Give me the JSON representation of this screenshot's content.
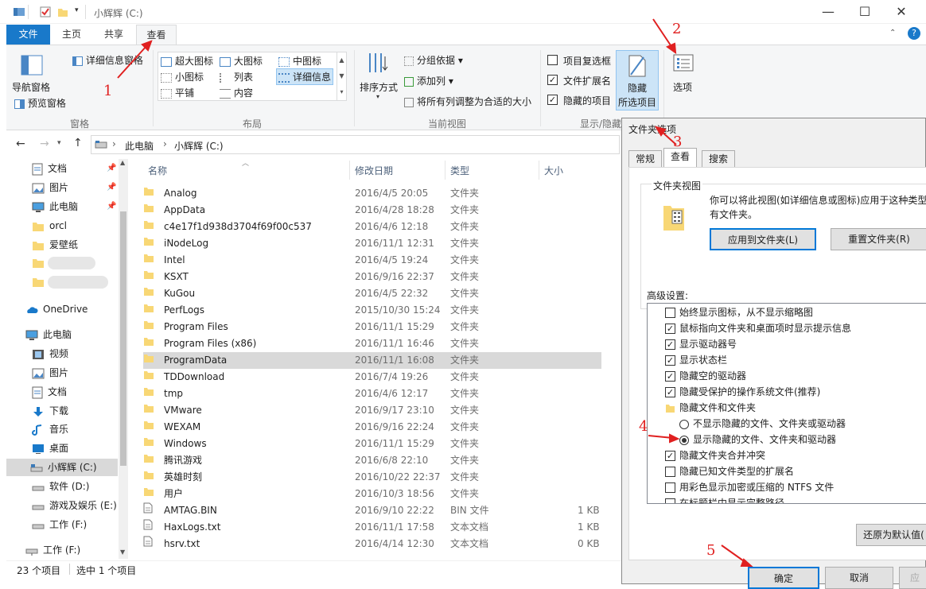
{
  "window": {
    "title": "小辉辉 (C:)",
    "controls": {
      "minimize": "—",
      "maximize": "☐",
      "close": "✕"
    }
  },
  "tabs": {
    "file": "文件",
    "home": "主页",
    "share": "共享",
    "view": "查看"
  },
  "ribbon": {
    "pane_group": {
      "nav_pane": "导航窗格",
      "preview_pane": "预览窗格",
      "details_pane": "详细信息窗格",
      "label": "窗格"
    },
    "layout_group": {
      "items": [
        "超大图标",
        "大图标",
        "中图标",
        "小图标",
        "列表",
        "详细信息",
        "平铺",
        "内容"
      ],
      "label": "布局"
    },
    "view_group": {
      "sort": "排序方式",
      "group_by": "分组依据",
      "add_column": "添加列",
      "fit_columns": "将所有列调整为合适的大小",
      "label": "当前视图"
    },
    "show_group": {
      "item_checkbox": "项目复选框",
      "file_ext": "文件扩展名",
      "hidden_items": "隐藏的项目",
      "hide_selected_1": "隐藏",
      "hide_selected_2": "所选项目",
      "label": "显示/隐藏"
    },
    "options": "选项"
  },
  "address": {
    "pc": "此电脑",
    "drive": "小辉辉 (C:)",
    "sep": "›"
  },
  "nav": {
    "quick": [
      {
        "label": "文档"
      },
      {
        "label": "图片"
      },
      {
        "label": "此电脑"
      },
      {
        "label": "orcl"
      },
      {
        "label": "爱壁纸"
      }
    ],
    "onedrive": "OneDrive",
    "thispc": "此电脑",
    "pc_items": [
      "视频",
      "图片",
      "文档",
      "下载",
      "音乐",
      "桌面",
      "小辉辉 (C:)",
      "软件 (D:)",
      "游戏及娱乐 (E:)",
      "工作 (F:)"
    ],
    "network": "工作 (F:)"
  },
  "columns": {
    "name": "名称",
    "date": "修改日期",
    "type": "类型",
    "size": "大小"
  },
  "files": [
    {
      "name": "Analog",
      "date": "2016/4/5 20:05",
      "type": "文件夹",
      "size": ""
    },
    {
      "name": "AppData",
      "date": "2016/4/28 18:28",
      "type": "文件夹",
      "size": ""
    },
    {
      "name": "c4e17f1d938d3704f69f00c537",
      "date": "2016/4/6 12:18",
      "type": "文件夹",
      "size": ""
    },
    {
      "name": "iNodeLog",
      "date": "2016/11/1 12:31",
      "type": "文件夹",
      "size": ""
    },
    {
      "name": "Intel",
      "date": "2016/4/5 19:24",
      "type": "文件夹",
      "size": ""
    },
    {
      "name": "KSXT",
      "date": "2016/9/16 22:37",
      "type": "文件夹",
      "size": ""
    },
    {
      "name": "KuGou",
      "date": "2016/4/5 22:32",
      "type": "文件夹",
      "size": ""
    },
    {
      "name": "PerfLogs",
      "date": "2015/10/30 15:24",
      "type": "文件夹",
      "size": ""
    },
    {
      "name": "Program Files",
      "date": "2016/11/1 15:29",
      "type": "文件夹",
      "size": ""
    },
    {
      "name": "Program Files (x86)",
      "date": "2016/11/1 16:46",
      "type": "文件夹",
      "size": ""
    },
    {
      "name": "ProgramData",
      "date": "2016/11/1 16:08",
      "type": "文件夹",
      "size": ""
    },
    {
      "name": "TDDownload",
      "date": "2016/7/4 19:26",
      "type": "文件夹",
      "size": ""
    },
    {
      "name": "tmp",
      "date": "2016/4/6 12:17",
      "type": "文件夹",
      "size": ""
    },
    {
      "name": "VMware",
      "date": "2016/9/17 23:10",
      "type": "文件夹",
      "size": ""
    },
    {
      "name": "WEXAM",
      "date": "2016/9/16 22:24",
      "type": "文件夹",
      "size": ""
    },
    {
      "name": "Windows",
      "date": "2016/11/1 15:29",
      "type": "文件夹",
      "size": ""
    },
    {
      "name": "腾讯游戏",
      "date": "2016/6/8 22:10",
      "type": "文件夹",
      "size": ""
    },
    {
      "name": "英雄时刻",
      "date": "2016/10/22 22:37",
      "type": "文件夹",
      "size": ""
    },
    {
      "name": "用户",
      "date": "2016/10/3 18:56",
      "type": "文件夹",
      "size": ""
    },
    {
      "name": "AMTAG.BIN",
      "date": "2016/9/10 22:22",
      "type": "BIN 文件",
      "size": "1 KB"
    },
    {
      "name": "HaxLogs.txt",
      "date": "2016/11/1 17:58",
      "type": "文本文档",
      "size": "1 KB"
    },
    {
      "name": "hsrv.txt",
      "date": "2016/4/14 12:30",
      "type": "文本文档",
      "size": "0 KB"
    }
  ],
  "selected_row": "ProgramData",
  "status": {
    "count": "23 个项目",
    "selected": "选中 1 个项目"
  },
  "dialog": {
    "title": "文件夹选项",
    "tabs": [
      "常规",
      "查看",
      "搜索"
    ],
    "folder_views": "文件夹视图",
    "folder_views_desc_1": "你可以将此视图(如详细信息或图标)应用于这种类型的",
    "folder_views_desc_2": "有文件夹。",
    "apply_btn": "应用到文件夹(L)",
    "reset_btn": "重置文件夹(R)",
    "advanced": "高级设置:",
    "settings": [
      {
        "kind": "check",
        "checked": false,
        "label": "始终显示图标，从不显示缩略图"
      },
      {
        "kind": "check",
        "checked": true,
        "label": "鼠标指向文件夹和桌面项时显示提示信息"
      },
      {
        "kind": "check",
        "checked": true,
        "label": "显示驱动器号"
      },
      {
        "kind": "check",
        "checked": true,
        "label": "显示状态栏"
      },
      {
        "kind": "check",
        "checked": true,
        "label": "隐藏空的驱动器"
      },
      {
        "kind": "check",
        "checked": true,
        "label": "隐藏受保护的操作系统文件(推荐)"
      },
      {
        "kind": "folder",
        "checked": false,
        "label": "隐藏文件和文件夹"
      },
      {
        "kind": "radio",
        "checked": false,
        "label": "不显示隐藏的文件、文件夹或驱动器"
      },
      {
        "kind": "radio",
        "checked": true,
        "label": "显示隐藏的文件、文件夹和驱动器"
      },
      {
        "kind": "check",
        "checked": true,
        "label": "隐藏文件夹合并冲突"
      },
      {
        "kind": "check",
        "checked": false,
        "label": "隐藏已知文件类型的扩展名"
      },
      {
        "kind": "check",
        "checked": false,
        "label": "用彩色显示加密或压缩的 NTFS 文件"
      },
      {
        "kind": "check",
        "checked": false,
        "label": "在标题栏中显示完整路径"
      }
    ],
    "restore_btn": "还原为默认值(",
    "ok": "确定",
    "cancel": "取消",
    "apply": "应"
  },
  "annotations": [
    "1",
    "2",
    "3",
    "4",
    "5"
  ],
  "colors": {
    "accent": "#1979ca",
    "folder": "#f8d775",
    "annotation": "#e02020",
    "selection": "#d9d9d9"
  }
}
